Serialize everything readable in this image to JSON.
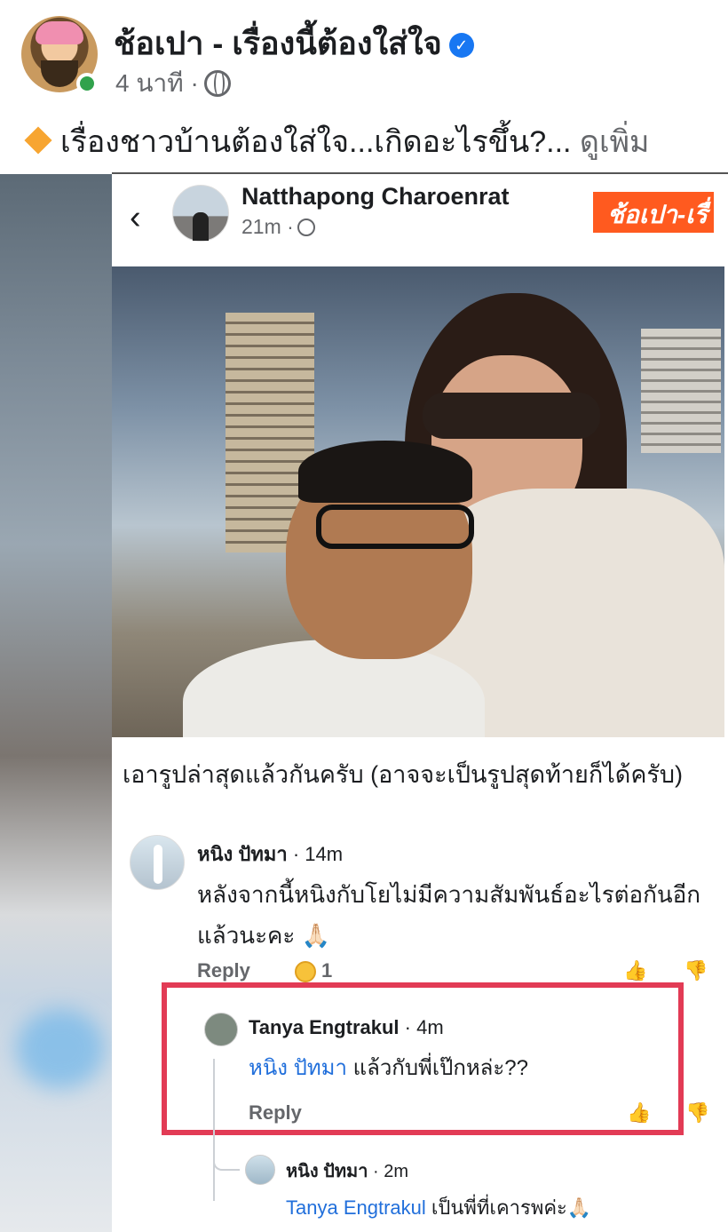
{
  "post": {
    "page_name": "ช้อเปา - เรื่องนี้ต้องใส่ใจ",
    "time": "4 นาที ·",
    "text": "เรื่องชาวบ้านต้องใส่ใจ...เกิดอะไรขึ้น?...",
    "see_more": "ดูเพิ่ม"
  },
  "embedded": {
    "author": "Natthapong Charoenrat",
    "time": "21m ·",
    "brand": "ช้อเปา-เรื่",
    "caption": "เอารูปล่าสุดแล้วกันครับ (อาจจะเป็นรูปสุดท้ายก็ได้ครับ)",
    "comments": [
      {
        "name": "หนิง ปัทมา",
        "time": "· 14m",
        "text": "หลังจากนี้หนิงกับโยไม่มีความสัมพันธ์อะไรต่อกันอีกแล้วนะคะ 🙏🏻",
        "reply_label": "Reply",
        "reaction_count": "1"
      },
      {
        "name": "Tanya Engtrakul",
        "time": "· 4m",
        "mention": "หนิง ปัทมา",
        "text": "แล้วกับพี่เป๊กหล่ะ??",
        "reply_label": "Reply"
      },
      {
        "name": "หนิง ปัทมา",
        "time": "· 2m",
        "mention": "Tanya Engtrakul",
        "text": "เป็นพี่ที่เคารพค่ะ🙏🏻"
      }
    ]
  },
  "colors": {
    "brand_orange": "#ff5a1f",
    "highlight_red": "#e23b55",
    "mention_blue": "#216fdb",
    "online_green": "#31a24c",
    "verified_blue": "#1877f2"
  },
  "icons": [
    "verified-badge-icon",
    "globe-icon",
    "diamond-icon",
    "back-chevron-icon",
    "like-icon",
    "dislike-icon",
    "reaction-emoji-icon"
  ]
}
